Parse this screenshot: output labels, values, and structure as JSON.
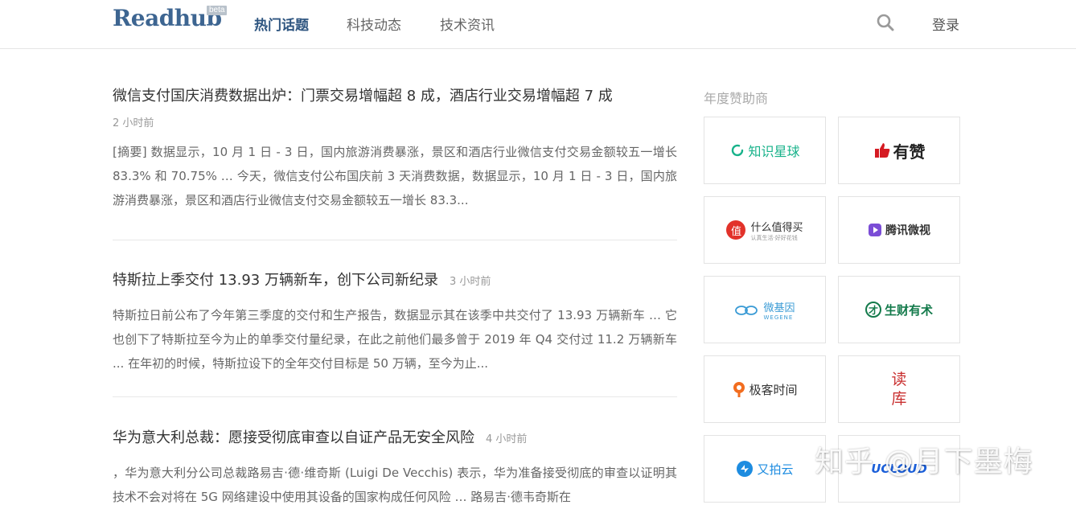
{
  "header": {
    "logo": "Readhub",
    "beta": "beta",
    "tabs": [
      "热门话题",
      "科技动态",
      "技术资讯"
    ],
    "login": "登录"
  },
  "news": [
    {
      "title": "微信支付国庆消费数据出炉：门票交易增幅超 8 成，酒店行业交易增幅超 7 成",
      "time": "2 小时前",
      "summary": "[摘要] 数据显示，10 月 1 日 - 3 日，国内旅游消费暴涨，景区和酒店行业微信支付交易金额较五一增长 83.3% 和 70.75% … 今天，微信支付公布国庆前 3 天消费数据，数据显示，10 月 1 日 - 3 日，国内旅游消费暴涨，景区和酒店行业微信支付交易金额较五一增长 83.3..."
    },
    {
      "title": "特斯拉上季交付 13.93 万辆新车，创下公司新纪录",
      "time": "3 小时前",
      "summary": "特斯拉日前公布了今年第三季度的交付和生产报告，数据显示其在该季中共交付了 13.93 万辆新车 … 它也创下了特斯拉至今为止的单季交付量纪录，在此之前他们最多曾于 2019 年 Q4 交付过 11.2 万辆新车 ... 在年初的时候，特斯拉设下的全年交付目标是 50 万辆，至今为止..."
    },
    {
      "title": "华为意大利总裁：愿接受彻底审查以自证产品无安全风险",
      "time": "4 小时前",
      "summary": "，华为意大利分公司总裁路易吉·德·维奇斯 (Luigi De Vecchis) 表示，华为准备接受彻底的审查以证明其技术不会对将在 5G 网络建设中使用其设备的国家构成任何风险 … 路易吉·德韦奇斯在"
    }
  ],
  "sidebar": {
    "title": "年度赞助商",
    "sponsors": [
      "知识星球",
      "有赞",
      "什么值得买",
      "腾讯微视",
      "微基因",
      "生财有术",
      "极客时间",
      "读库",
      "又拍云",
      "UCLOUD"
    ],
    "sponsor_subs": {
      "smzdm": "认真生活·好好花钱",
      "wegene": "WEGENE",
      "smzdm_glyph": "值",
      "shengcai_glyph": "才",
      "duku_line1": "读",
      "duku_line2": "库"
    }
  },
  "watermark": "知乎 @月下墨梅",
  "colors": {
    "brand": "#3d6591",
    "zsxq": "#17b28a",
    "youzan": "#d51a22",
    "smzdm": "#e2322a",
    "weishi": "#7b4dd6",
    "wegene": "#3a9bd5",
    "shengcai": "#137a4b",
    "geek": "#f26d1f",
    "upyun": "#1d8ce0",
    "ucloud": "#1b5fd9"
  }
}
